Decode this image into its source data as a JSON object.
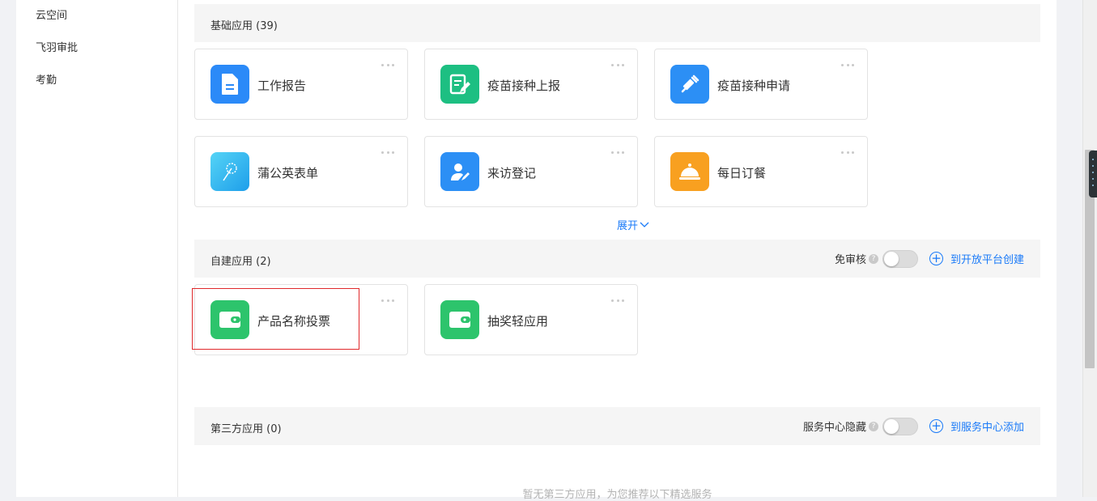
{
  "sidebar": {
    "items": [
      {
        "label": "云空间"
      },
      {
        "label": "飞羽审批"
      },
      {
        "label": "考勤"
      }
    ]
  },
  "sections": {
    "basic": {
      "title": "基础应用 (39)",
      "apps": [
        {
          "name": "工作报告",
          "icon": "document-icon",
          "color": "#2b8af8"
        },
        {
          "name": "疫苗接种上报",
          "icon": "form-pen-icon",
          "color": "#1dbf82"
        },
        {
          "name": "疫苗接种申请",
          "icon": "syringe-icon",
          "color": "#2c8ff5"
        },
        {
          "name": "蒲公英表单",
          "icon": "dandelion-icon",
          "color": "#2fb3f2"
        },
        {
          "name": "来访登记",
          "icon": "visitor-icon",
          "color": "#2c8ff5"
        },
        {
          "name": "每日订餐",
          "icon": "meal-cloche-icon",
          "color": "#f8a020"
        }
      ],
      "expand_label": "展开"
    },
    "custom": {
      "title": "自建应用 (2)",
      "toggle_label": "免审核",
      "link_label": "到开放平台创建",
      "apps": [
        {
          "name": "产品名称投票",
          "icon": "wallet-icon",
          "color": "#2dc46c"
        },
        {
          "name": "抽奖轻应用",
          "icon": "wallet-icon",
          "color": "#2dc46c"
        }
      ]
    },
    "third_party": {
      "title": "第三方应用 (0)",
      "toggle_label": "服务中心隐藏",
      "link_label": "到服务中心添加",
      "empty_note": "暂无第三方应用，为您推荐以下精选服务"
    }
  },
  "colors": {
    "accent": "#1a7af8",
    "highlight_border": "#e0292b"
  }
}
